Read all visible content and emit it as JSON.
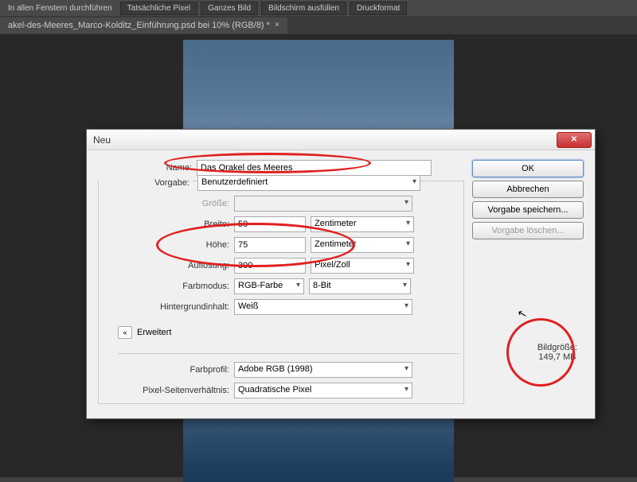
{
  "toolbar": {
    "label": "In allen Fenstern durchführen",
    "buttons": [
      "Tatsächliche Pixel",
      "Ganzes Bild",
      "Bildschirm ausfüllen",
      "Druckformat"
    ]
  },
  "tab": {
    "title": "akel-des-Meeres_Marco-Kolditz_Einführung.psd bei 10% (RGB/8) *"
  },
  "dialog": {
    "title": "Neu",
    "labels": {
      "name": "Name:",
      "preset": "Vorgabe:",
      "size": "Größe:",
      "width": "Breite:",
      "height": "Höhe:",
      "resolution": "Auflösung:",
      "colormode": "Farbmodus:",
      "bgcontent": "Hintergrundinhalt:",
      "advanced": "Erweitert",
      "colorprofile": "Farbprofil:",
      "pixelratio": "Pixel-Seitenverhältnis:"
    },
    "values": {
      "name": "Das Orakel des Meeres",
      "preset": "Benutzerdefiniert",
      "size": "",
      "width": "50",
      "height": "75",
      "width_unit": "Zentimeter",
      "height_unit": "Zentimeter",
      "resolution": "300",
      "resolution_unit": "Pixel/Zoll",
      "colormode": "RGB-Farbe",
      "bitdepth": "8-Bit",
      "bgcontent": "Weiß",
      "colorprofile": "Adobe RGB (1998)",
      "pixelratio": "Quadratische Pixel"
    },
    "buttons": {
      "ok": "OK",
      "cancel": "Abbrechen",
      "save_preset": "Vorgabe speichern...",
      "delete_preset": "Vorgabe löschen..."
    },
    "sizeinfo": {
      "label": "Bildgröße:",
      "value": "149,7 MB"
    }
  }
}
